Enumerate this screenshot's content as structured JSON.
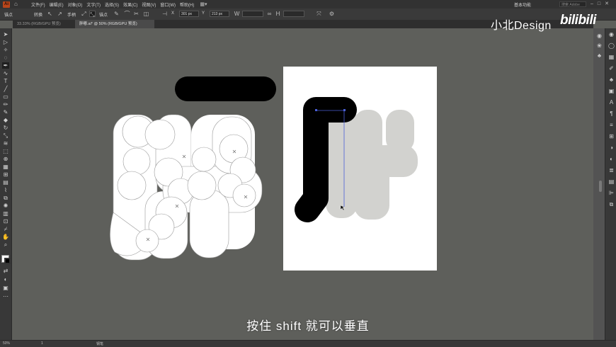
{
  "menubar": {
    "logo": "Ai",
    "items": [
      "文件(F)",
      "编辑(E)",
      "对象(O)",
      "文字(T)",
      "选择(S)",
      "效果(C)",
      "视图(V)",
      "窗口(W)",
      "帮助(H)"
    ],
    "workspace": "基本功能",
    "search_placeholder": "搜索 Adobe Stock"
  },
  "optionbar": {
    "anchor_label": "锚点",
    "convert_label": "转换",
    "handle_label": "手柄",
    "anchor_point_label": "锚点",
    "x_label": "X",
    "x_value": "301 px",
    "y_label": "Y",
    "y_value": "213 px"
  },
  "tabs": [
    {
      "label": "33.33% (RGB/GPU 预览)",
      "active": false
    },
    {
      "label": "胖嘟.ai* @ 50% (RGB/GPU 预览)",
      "active": true
    }
  ],
  "statusbar": {
    "zoom": "50%",
    "page": "1",
    "tool_name": "钢笔"
  },
  "watermark": {
    "brand_text": "小北Design",
    "platform_text": "bilibili"
  },
  "subtitle": "按住 shift 就可以垂直",
  "colors": {
    "canvas_bg": "#5e5f5b",
    "artboard": "#ffffff",
    "glyph_fill": "#ffffff",
    "glyph_ghost": "#d2d2cf",
    "stroke_black": "#000000",
    "path_selection": "#4a5fd6"
  }
}
